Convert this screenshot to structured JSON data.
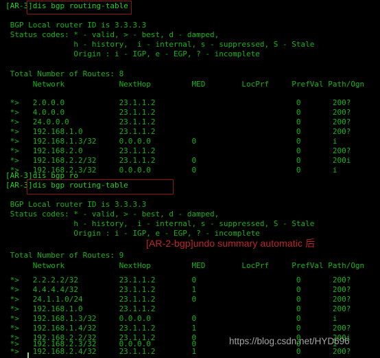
{
  "terminal": {
    "colors": {
      "background": "#000000",
      "foreground": "#16b316",
      "annotation_red": "#c0232b",
      "box_red": "#8f1414",
      "watermark": "#c9c9c9"
    },
    "watermark": "https://blog.csdn.net/HYD696"
  },
  "annotation": {
    "text": "[AR-2-bgp]undo summary automatic 后"
  },
  "session": {
    "prompt": "[AR-3]",
    "commands": {
      "first": "dis bgp routing-table",
      "second": "dis bgp ro",
      "third": "dis bgp routing-table"
    }
  },
  "block1": {
    "prompt_line": "[AR-3]dis bgp routing-table",
    "router_id_line": " BGP Local router ID is 3.3.3.3",
    "status_codes_line1": " Status codes: * - valid, > - best, d - damped,",
    "status_codes_line2": "               h - history,  i - internal, s - suppressed, S - Stale",
    "status_codes_line3": "               Origin : i - IGP, e - EGP, ? - incomplete",
    "total_line": " Total Number of Routes: 8",
    "header_line": "      Network            NextHop         MED        LocPrf     PrefVal Path/Ogn",
    "total_routes": 8,
    "headers": [
      "Network",
      "NextHop",
      "MED",
      "LocPrf",
      "PrefVal",
      "Path/Ogn"
    ],
    "rows": [
      " *>   2.0.0.0            23.1.1.2                               0       200?",
      " *>   4.0.0.0            23.1.1.2                               0       200?",
      " *>   24.0.0.0           23.1.1.2                               0       200?",
      " *>   192.168.1.0        23.1.1.2                               0       200?",
      " *>   192.168.1.3/32     0.0.0.0         0                      0       i",
      " *>   192.168.2.0        23.1.1.2                               0       200?",
      " *>   192.168.2.2/32     23.1.1.2        0                      0       200i",
      " *>   192.168.2.3/32     0.0.0.0         0                      0       i"
    ],
    "routes": [
      {
        "status": "*>",
        "network": "2.0.0.0",
        "nexthop": "23.1.1.2",
        "med": "",
        "locprf": "",
        "prefval": "0",
        "path_ogn": "200?"
      },
      {
        "status": "*>",
        "network": "4.0.0.0",
        "nexthop": "23.1.1.2",
        "med": "",
        "locprf": "",
        "prefval": "0",
        "path_ogn": "200?"
      },
      {
        "status": "*>",
        "network": "24.0.0.0",
        "nexthop": "23.1.1.2",
        "med": "",
        "locprf": "",
        "prefval": "0",
        "path_ogn": "200?"
      },
      {
        "status": "*>",
        "network": "192.168.1.0",
        "nexthop": "23.1.1.2",
        "med": "",
        "locprf": "",
        "prefval": "0",
        "path_ogn": "200?"
      },
      {
        "status": "*>",
        "network": "192.168.1.3/32",
        "nexthop": "0.0.0.0",
        "med": "0",
        "locprf": "",
        "prefval": "0",
        "path_ogn": "i"
      },
      {
        "status": "*>",
        "network": "192.168.2.0",
        "nexthop": "23.1.1.2",
        "med": "",
        "locprf": "",
        "prefval": "0",
        "path_ogn": "200?"
      },
      {
        "status": "*>",
        "network": "192.168.2.2/32",
        "nexthop": "23.1.1.2",
        "med": "0",
        "locprf": "",
        "prefval": "0",
        "path_ogn": "200i"
      },
      {
        "status": "*>",
        "network": "192.168.2.3/32",
        "nexthop": "0.0.0.0",
        "med": "0",
        "locprf": "",
        "prefval": "0",
        "path_ogn": "i"
      }
    ]
  },
  "interlude": {
    "line1": "[AR-3]dis bgp ro",
    "line2": "[AR-3]dis bgp routing-table"
  },
  "block2": {
    "router_id_line": " BGP Local router ID is 3.3.3.3",
    "status_codes_line1": " Status codes: * - valid, > - best, d - damped,",
    "status_codes_line2": "               h - history,  i - internal, s - suppressed, S - Stale",
    "status_codes_line3": "               Origin : i - IGP, e - EGP, ? - incomplete",
    "total_line": " Total Number of Routes: 9",
    "header_line": "      Network            NextHop         MED        LocPrf     PrefVal Path/Ogn",
    "total_routes": 9,
    "headers": [
      "Network",
      "NextHop",
      "MED",
      "LocPrf",
      "PrefVal",
      "Path/Ogn"
    ],
    "rows": [
      " *>   2.2.2.2/32         23.1.1.2        0                      0       200?",
      " *>   4.4.4.4/32         23.1.1.2        1                      0       200?",
      " *>   24.1.1.0/24        23.1.1.2        0                      0       200?",
      " *>   192.168.1.0        23.1.1.2                               0       200?",
      " *>   192.168.1.3/32     0.0.0.0         0                      0       i",
      " *>   192.168.1.4/32     23.1.1.2        1                      0       200?",
      " *>   192.168.2.2/32     23.1.1.2        0                      0       200i",
      " *>   192.168.2.3/32     0.0.0.0         0                      0       i",
      " *>   192.168.2.4/32     23.1.1.2        1                      0       200?"
    ],
    "routes": [
      {
        "status": "*>",
        "network": "2.2.2.2/32",
        "nexthop": "23.1.1.2",
        "med": "0",
        "locprf": "",
        "prefval": "0",
        "path_ogn": "200?"
      },
      {
        "status": "*>",
        "network": "4.4.4.4/32",
        "nexthop": "23.1.1.2",
        "med": "1",
        "locprf": "",
        "prefval": "0",
        "path_ogn": "200?"
      },
      {
        "status": "*>",
        "network": "24.1.1.0/24",
        "nexthop": "23.1.1.2",
        "med": "0",
        "locprf": "",
        "prefval": "0",
        "path_ogn": "200?"
      },
      {
        "status": "*>",
        "network": "192.168.1.0",
        "nexthop": "23.1.1.2",
        "med": "",
        "locprf": "",
        "prefval": "0",
        "path_ogn": "200?"
      },
      {
        "status": "*>",
        "network": "192.168.1.3/32",
        "nexthop": "0.0.0.0",
        "med": "0",
        "locprf": "",
        "prefval": "0",
        "path_ogn": "i"
      },
      {
        "status": "*>",
        "network": "192.168.1.4/32",
        "nexthop": "23.1.1.2",
        "med": "1",
        "locprf": "",
        "prefval": "0",
        "path_ogn": "200?"
      },
      {
        "status": "*>",
        "network": "192.168.2.2/32",
        "nexthop": "23.1.1.2",
        "med": "0",
        "locprf": "",
        "prefval": "0",
        "path_ogn": "200i"
      },
      {
        "status": "*>",
        "network": "192.168.2.3/32",
        "nexthop": "0.0.0.0",
        "med": "0",
        "locprf": "",
        "prefval": "0",
        "path_ogn": "i"
      },
      {
        "status": "*>",
        "network": "192.168.2.4/32",
        "nexthop": "23.1.1.2",
        "med": "1",
        "locprf": "",
        "prefval": "0",
        "path_ogn": "200?"
      }
    ]
  }
}
